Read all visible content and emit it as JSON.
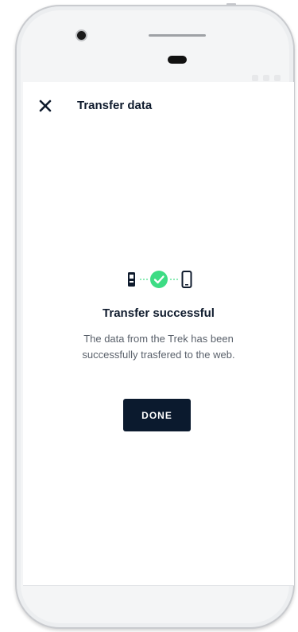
{
  "header": {
    "title": "Transfer data",
    "close_icon": "close-icon"
  },
  "graphic": {
    "source_icon": "tracker-device-icon",
    "status_icon": "check-circle-icon",
    "target_icon": "smartphone-icon",
    "success_color": "#3ddc84"
  },
  "message": {
    "title": "Transfer successful",
    "description": "The data from the Trek has been successfully trasfered to the web."
  },
  "actions": {
    "done_label": "DONE"
  },
  "colors": {
    "primary_dark": "#0b1a2e",
    "text_muted": "#5a616b"
  }
}
